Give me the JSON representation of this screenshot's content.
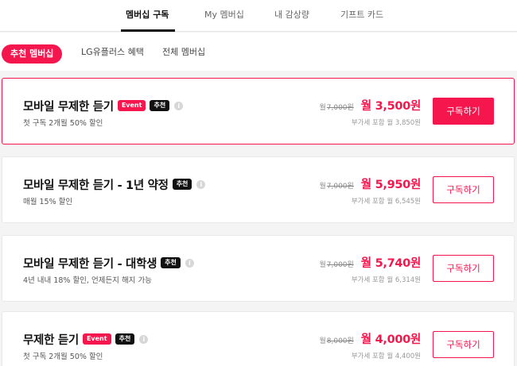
{
  "top_tabs": [
    {
      "label": "멤버십 구독"
    },
    {
      "label": "My 멤버십"
    },
    {
      "label": "내 감상량"
    },
    {
      "label": "기프트 카드"
    }
  ],
  "filter_chips": [
    {
      "label": "추천 멤버십"
    },
    {
      "label": "LG유플러스 혜택"
    },
    {
      "label": "전체 멤버십"
    }
  ],
  "info_icon_glyph": "i",
  "plans": [
    {
      "name": "모바일 무제한 듣기",
      "badge_event": "Event",
      "badge_rec": "추천",
      "desc": "첫 구독 2개월 50% 할인",
      "unit": "월",
      "orig_price": "7,000원",
      "final_price": "월 3,500원",
      "vat_note": "부가세 포함 월 3,850원",
      "button": "구독하기"
    },
    {
      "name": "모바일 무제한 듣기 - 1년 약정",
      "badge_rec": "추천",
      "desc": "매월 15% 할인",
      "unit": "월",
      "orig_price": "7,000원",
      "final_price": "월 5,950원",
      "vat_note": "부가세 포함 월 6,545원",
      "button": "구독하기"
    },
    {
      "name": "모바일 무제한 듣기 - 대학생",
      "badge_rec": "추천",
      "desc": "4년 내내 18% 할인, 언제든지 해지 가능",
      "unit": "월",
      "orig_price": "7,000원",
      "final_price": "월 5,740원",
      "vat_note": "부가세 포함 월 6,314원",
      "button": "구독하기"
    },
    {
      "name": "무제한 듣기",
      "badge_event": "Event",
      "badge_rec": "추천",
      "desc": "첫 구독 2개월 50% 할인",
      "unit": "월",
      "orig_price": "8,000원",
      "final_price": "월 4,000원",
      "vat_note": "부가세 포함 월 4,400원",
      "button": "구독하기"
    }
  ],
  "colors": {
    "accent": "#f5164d",
    "badge_dark": "#111111",
    "background": "#f4f4f4"
  }
}
